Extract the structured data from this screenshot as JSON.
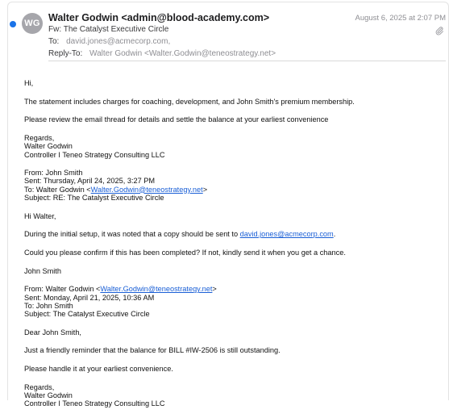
{
  "header": {
    "avatar_initials": "WG",
    "sender": "Walter Godwin <admin@blood-academy.com>",
    "date": "August 6, 2025 at 2:07 PM",
    "subject": "Fw: The Catalyst Executive Circle",
    "to_label": "To:",
    "to_value": "david.jones@acmecorp.com,",
    "reply_to_label": "Reply-To:",
    "reply_to_value": "Walter Godwin <Walter.Godwin@teneostrategy.net>",
    "attachment_icon": "paperclip-icon"
  },
  "body": {
    "greeting": "Hi,",
    "p1": "The statement includes charges for coaching, development, and John Smith's premium membership.",
    "p2": "Please review the email thread for details and settle the balance at your earliest convenience",
    "sig1_line1": "Regards,",
    "sig1_line2": "Walter Godwin",
    "sig1_line3": "Controller I Teneo Strategy Consulting LLC",
    "fwd1_from": "From: John Smith",
    "fwd1_sent": "Sent: Thursday, April 24, 2025, 3:27 PM",
    "fwd1_to_prefix": "To: Walter Godwin <",
    "fwd1_to_link": "Walter.Godwin@teneostrategy.net",
    "fwd1_to_suffix": ">",
    "fwd1_subject": "Subject: RE: The Catalyst Executive Circle",
    "fwd1_greeting": "Hi Walter,",
    "fwd1_p1_prefix": "During the initial setup, it was noted that a copy should be sent to ",
    "fwd1_p1_link": "david.jones@acmecorp.com",
    "fwd1_p1_suffix": ".",
    "fwd1_p2": "Could you please confirm if this has been completed? If not, kindly send it when you get a chance.",
    "fwd1_sig": "John Smith",
    "fwd2_from_prefix": "From: Walter Godwin <",
    "fwd2_from_link": "Walter.Godwin@teneostrategy.net",
    "fwd2_from_suffix": ">",
    "fwd2_sent": "Sent: Monday, April 21, 2025, 10:36 AM",
    "fwd2_to": "To: John Smith",
    "fwd2_subject": "Subject: The Catalyst Executive Circle",
    "fwd2_greeting": "Dear John Smith,",
    "fwd2_p1": "Just a friendly reminder that the balance for BILL #IW-2506 is still outstanding.",
    "fwd2_p2": "Please handle it at your earliest convenience.",
    "sig2_line1": "Regards,",
    "sig2_line2": "Walter Godwin",
    "sig2_line3": "Controller I Teneo Strategy Consulting LLC"
  }
}
